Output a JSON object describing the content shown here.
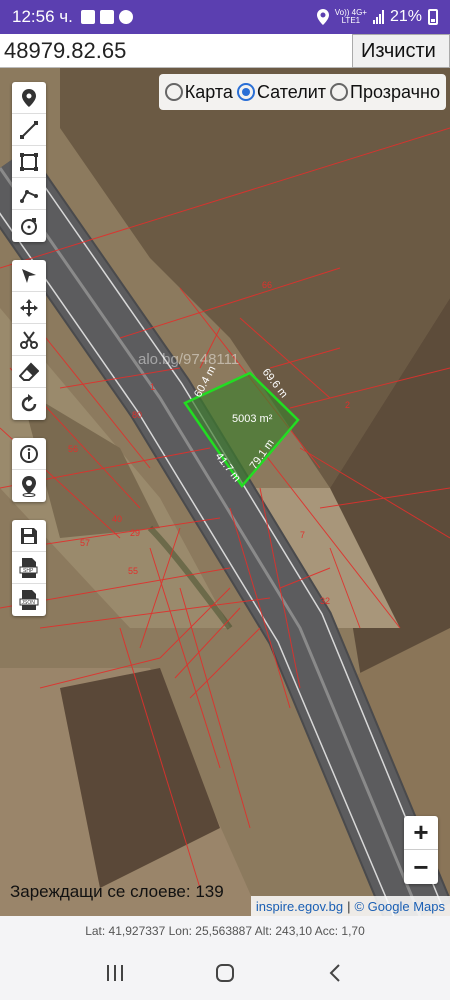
{
  "status_bar": {
    "time": "12:56 ч.",
    "network_top": "Vo)) 4G+",
    "network_bottom": "LTE1",
    "battery": "21%"
  },
  "top": {
    "coordinate_value": "48979.82.65",
    "clear_label": "Изчисти"
  },
  "layer_options": [
    {
      "label": "Карта",
      "selected": false
    },
    {
      "label": "Сателит",
      "selected": true
    },
    {
      "label": "Прозрачно",
      "selected": false
    }
  ],
  "tools_group1": [
    "marker-icon",
    "line-icon",
    "polygon-icon",
    "path-icon",
    "circle-icon"
  ],
  "tools_group2": [
    "cursor-icon",
    "move-icon",
    "cut-icon",
    "eraser-icon",
    "rotate-icon"
  ],
  "tools_group3": [
    "info-icon",
    "location-pin-icon"
  ],
  "tools_group4": [
    "save-icon",
    "shp-file-icon",
    "json-file-icon"
  ],
  "map": {
    "watermark": "alo.bg/9748111",
    "parcel": {
      "area": "5003 m²",
      "side_a": "60.4 m",
      "side_b": "69.6 m",
      "side_c": "41.7 m",
      "side_d": "79.1 m",
      "outline_color": "#22dd22"
    },
    "parcel_numbers": [
      "56",
      "40",
      "55",
      "57",
      "29",
      "1",
      "80",
      "66",
      "7",
      "32",
      "2"
    ],
    "loading_layers": "Зареждащи се слоеве: 139",
    "attribution_source": "inspire.egov.bg",
    "attribution_sep": "|",
    "attribution_google": "© Google Maps"
  },
  "zoom": {
    "in": "+",
    "out": "−"
  },
  "info": "Lat: 41,927337 Lon: 25,563887 Alt: 243,10 Acc: 1,70"
}
